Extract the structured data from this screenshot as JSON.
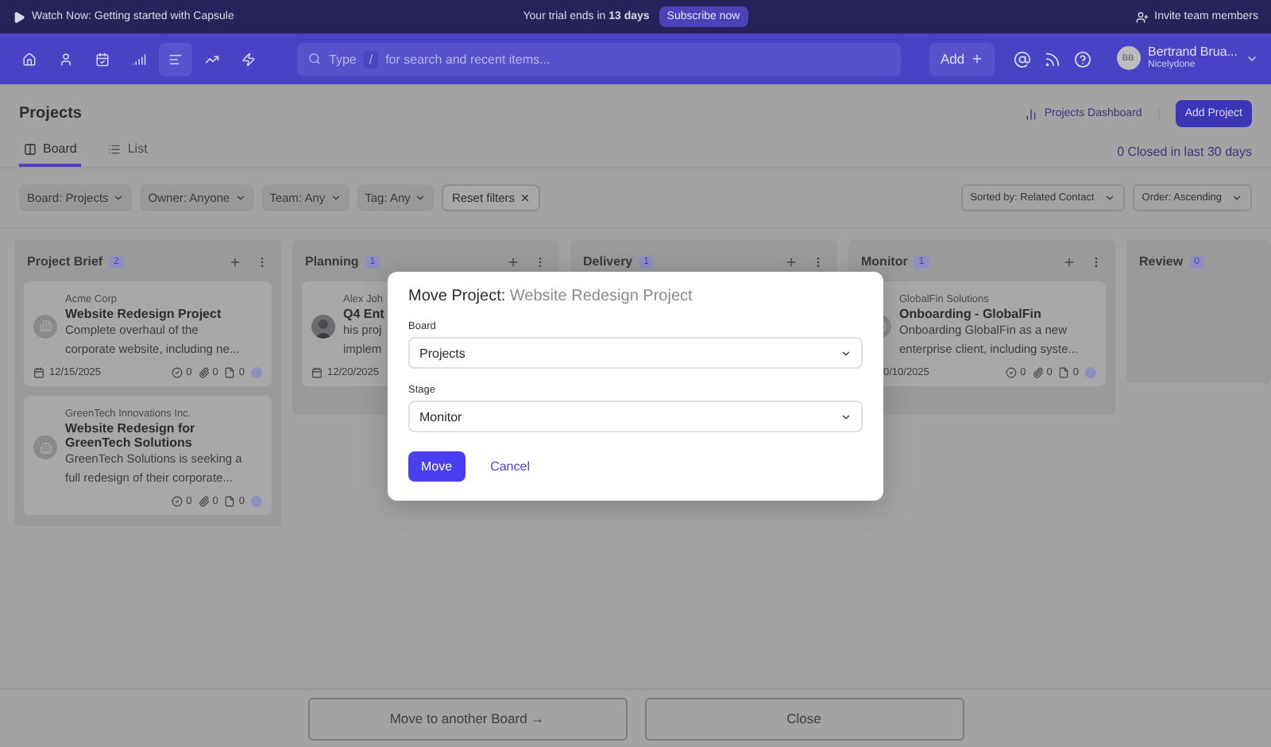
{
  "banner": {
    "watch": "Watch Now: Getting started with Capsule",
    "trial": "Your trial ends in **13 days**",
    "subscribe": "Subscribe now",
    "invite": "Invite team members"
  },
  "nav": {
    "items": [
      {
        "kind": "home",
        "selected": false
      },
      {
        "kind": "person",
        "selected": false
      },
      {
        "kind": "calendar",
        "selected": false
      },
      {
        "kind": "signal",
        "selected": false
      },
      {
        "kind": "projects",
        "selected": true
      },
      {
        "kind": "trend",
        "selected": false
      },
      {
        "kind": "bolt",
        "selected": false
      }
    ],
    "search": {
      "prefix": "Type",
      "key": "/",
      "placeholder": "for search and recent items..."
    },
    "add": "Add",
    "user": {
      "initials": "BB",
      "name": "Bertrand Brua...",
      "org": "Nicelydone"
    }
  },
  "page": {
    "title": "Projects",
    "tabs": [
      {
        "label": "Board",
        "kind": "board",
        "selected": true
      },
      {
        "label": "List",
        "kind": "list",
        "selected": false
      }
    ],
    "dashboard": "Projects Dashboard",
    "add_project": "Add Project",
    "closed": "0 Closed in last 30 days"
  },
  "filters": [
    {
      "label": "Board:",
      "value": "Projects"
    },
    {
      "label": "Owner:",
      "value": "Anyone"
    },
    {
      "label": "Team:",
      "value": "Any"
    },
    {
      "label": "Tag:",
      "value": "Any"
    }
  ],
  "reset": "Reset filters",
  "sort": "Sorted by: Related Contact",
  "order": "Order: Ascending",
  "columns": [
    {
      "title": "Project Brief",
      "count": "2",
      "cards": [
        {
          "kind": "building",
          "company": "Acme Corp",
          "title": "Website Redesign Project",
          "description": [
            "Complete overhaul of the",
            "corporate website, including ne..."
          ],
          "date": "12/15/2025",
          "date_icon": true,
          "tasks": "0",
          "attachments": "0",
          "files": "0"
        },
        {
          "kind": "building",
          "company": "GreenTech Innovations Inc.",
          "title": "Website Redesign for GreenTech Solutions",
          "description": [
            "GreenTech Solutions is seeking a",
            "full redesign of their corporate..."
          ],
          "tasks": "0",
          "attachments": "0",
          "files": "0"
        }
      ]
    },
    {
      "title": "Planning",
      "count": "1",
      "cards": [
        {
          "kind": "picture",
          "company": "Alex Joh",
          "title": "Q4 Ent",
          "description": [
            "his proj",
            "implem"
          ],
          "date": "12/20/2025",
          "date_icon": true
        }
      ]
    },
    {
      "title": "Delivery",
      "count": "1"
    },
    {
      "title": "Monitor",
      "count": "1",
      "cards": [
        {
          "kind": "building",
          "company": "GlobalFin Solutions",
          "title": "Onboarding - GlobalFin",
          "description": [
            "Onboarding GlobalFin as a new",
            "enterprise client, including syste..."
          ],
          "date": "0/10/2025",
          "tasks": "0",
          "attachments": "0",
          "files": "0"
        }
      ]
    },
    {
      "title": "Review",
      "count": "0"
    }
  ],
  "modal": {
    "title": "Move Project:",
    "project": "Website Redesign Project",
    "fields": [
      {
        "label": "Board",
        "value": "Projects"
      },
      {
        "label": "Stage",
        "value": "Monitor"
      }
    ],
    "move": "Move",
    "cancel": "Cancel"
  },
  "footer": {
    "buttons": [
      "Move to another Board →",
      "Close"
    ]
  }
}
